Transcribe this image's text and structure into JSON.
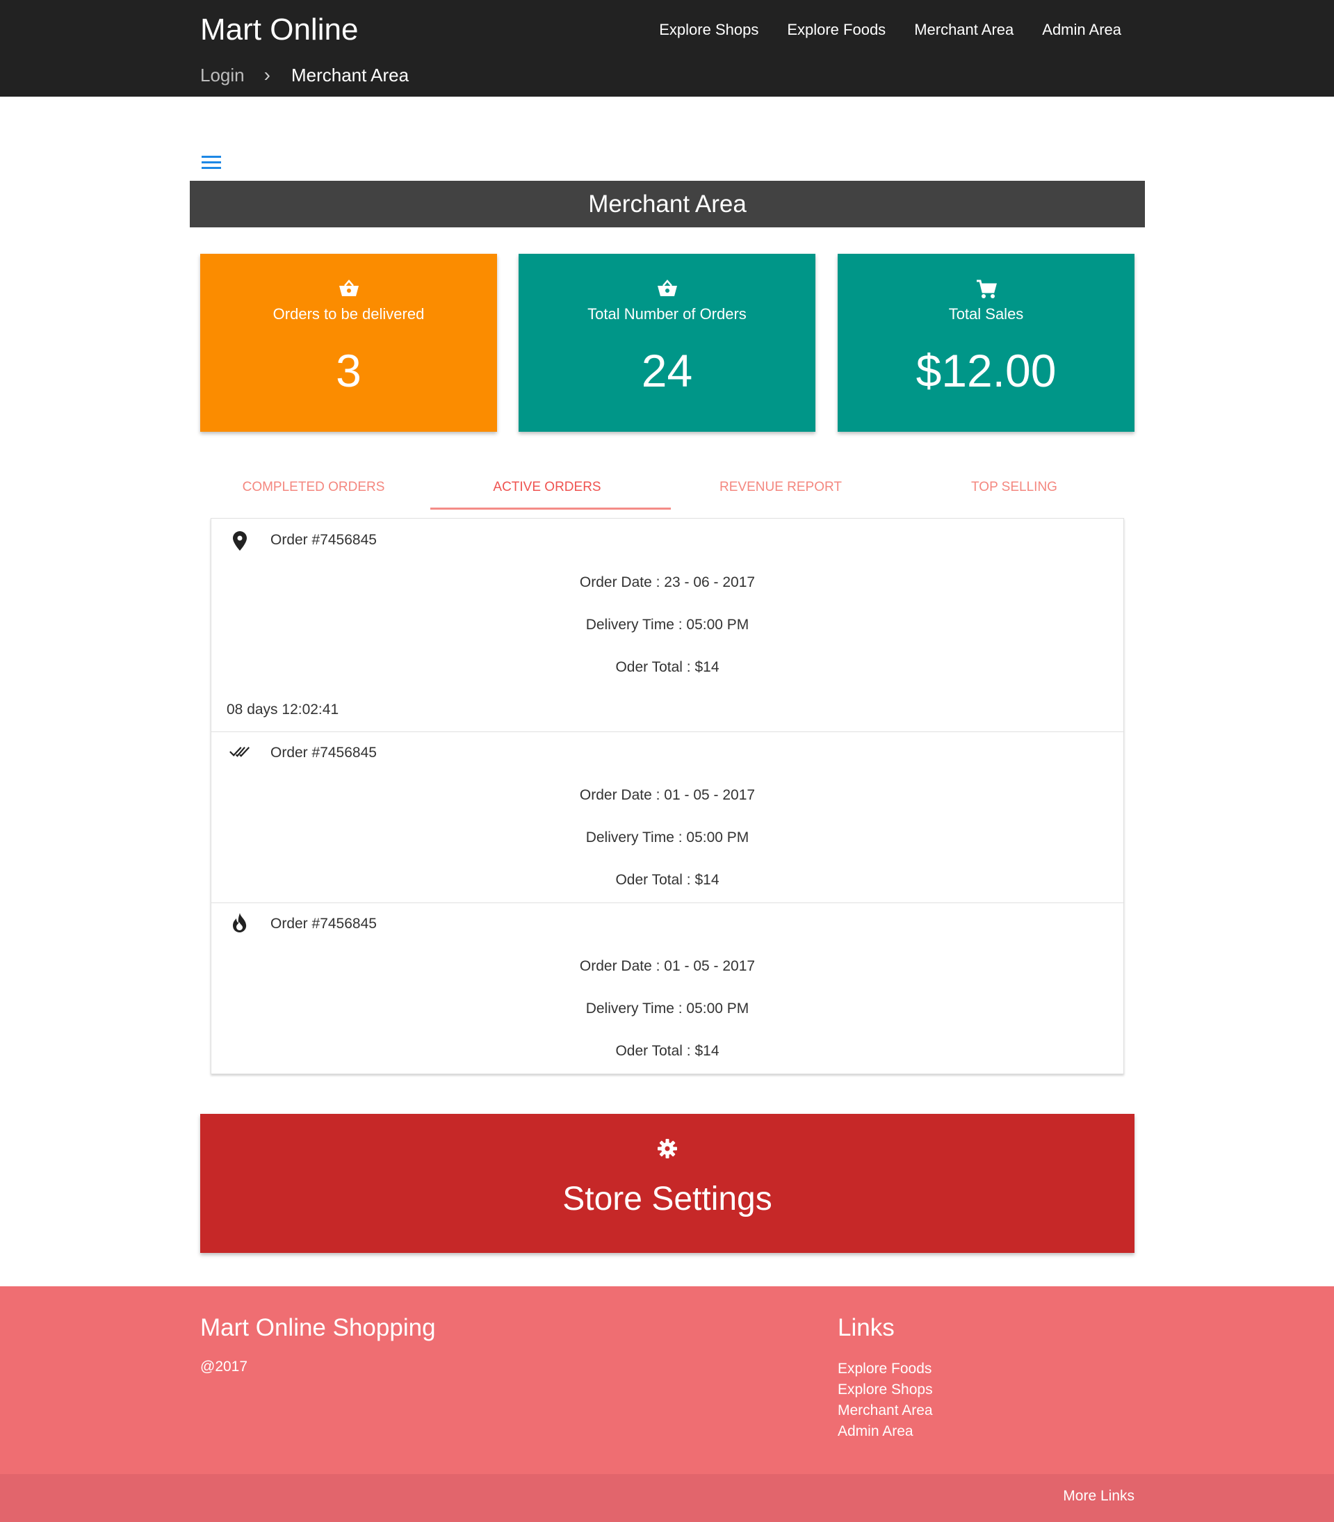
{
  "header": {
    "brand": "Mart Online",
    "nav": [
      "Explore Shops",
      "Explore Foods",
      "Merchant Area",
      "Admin Area"
    ],
    "breadcrumb": {
      "login": "Login",
      "separator": "›",
      "current": "Merchant Area"
    }
  },
  "menu_icon": "hamburger-menu-icon",
  "title": "Merchant Area",
  "cards": [
    {
      "label": "Orders to be delivered",
      "value": "3",
      "icon": "basket-icon",
      "color": "#fb8c00"
    },
    {
      "label": "Total Number of Orders",
      "value": "24",
      "icon": "basket-icon",
      "color": "#009688"
    },
    {
      "label": "Total Sales",
      "value": "$12.00",
      "icon": "cart-icon",
      "color": "#009688"
    }
  ],
  "tabs": [
    "COMPLETED ORDERS",
    "ACTIVE ORDERS",
    "REVENUE REPORT",
    "TOP SELLING"
  ],
  "active_tab": "ACTIVE ORDERS",
  "orders": [
    {
      "icon": "location-pin-icon",
      "title": "Order #7456845",
      "date": "Order Date : 23 - 06 - 2017",
      "delivery": "Delivery Time : 05:00 PM",
      "total": "Oder Total : $14",
      "timer": "08 days 12:02:41"
    },
    {
      "icon": "double-check-icon",
      "title": "Order #7456845",
      "date": "Order Date : 01 - 05 - 2017",
      "delivery": "Delivery Time : 05:00 PM",
      "total": "Oder Total : $14"
    },
    {
      "icon": "flame-icon",
      "title": "Order #7456845",
      "date": "Order Date : 01 - 05 - 2017",
      "delivery": "Delivery Time : 05:00 PM",
      "total": "Oder Total : $14"
    }
  ],
  "settings": {
    "label": "Store Settings",
    "icon": "gear-icon",
    "color": "#c62828"
  },
  "footer": {
    "title": "Mart Online Shopping",
    "copyright": "@2017",
    "links_title": "Links",
    "links": [
      "Explore Foods",
      "Explore Shops",
      "Merchant Area",
      "Admin Area"
    ],
    "more": "More Links"
  },
  "colors": {
    "header_bg": "#222222",
    "titlebar_bg": "#424242",
    "tab_accent": "#ef5350",
    "footer_bg": "#ef6e72",
    "footer_bottom_bg": "#e2656c"
  }
}
